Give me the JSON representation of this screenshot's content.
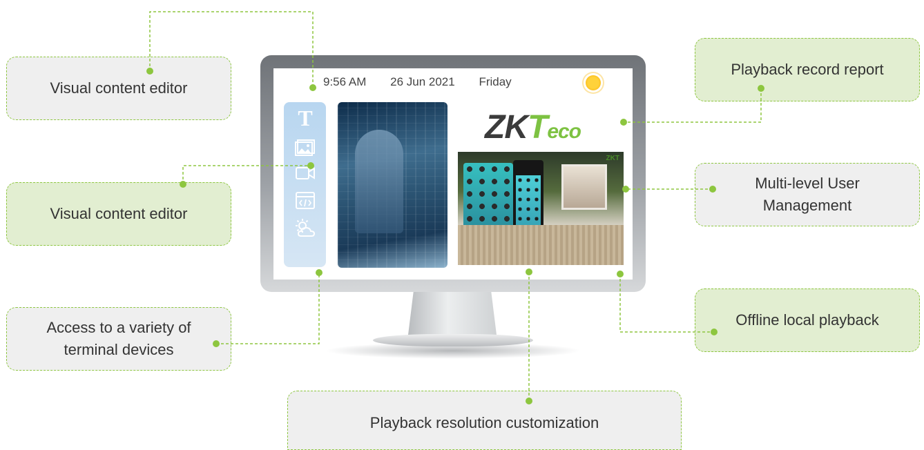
{
  "screen": {
    "time": "9:56 AM",
    "date": "26 Jun 2021",
    "day": "Friday",
    "weather_icon": "sun-icon",
    "sidebar_icons": [
      "text-icon",
      "image-icon",
      "video-icon",
      "web-code-icon",
      "weather-icon"
    ],
    "sidebar_text_glyph": "T",
    "logo_zk": "ZK",
    "logo_t": "T",
    "logo_eco": "eco",
    "photo_badge": "ZKT"
  },
  "callouts": [
    {
      "id": "visual-content-editor-top",
      "text": "Visual content editor",
      "style": "grey"
    },
    {
      "id": "visual-content-editor",
      "text": "Visual content editor",
      "style": "green"
    },
    {
      "id": "access-terminal-devices",
      "text": "Access to a variety of\nterminal devices",
      "style": "grey"
    },
    {
      "id": "playback-resolution",
      "text": "Playback resolution customization",
      "style": "grey"
    },
    {
      "id": "playback-record-report",
      "text": "Playback record report",
      "style": "green"
    },
    {
      "id": "multi-level-user",
      "text": "Multi-level User\nManagement",
      "style": "grey"
    },
    {
      "id": "offline-local-playback",
      "text": "Offline local playback",
      "style": "green"
    }
  ],
  "colors": {
    "accent_green": "#8dc63f",
    "callout_grey": "#efefef",
    "callout_green": "#e2eed1",
    "text": "#333333"
  }
}
